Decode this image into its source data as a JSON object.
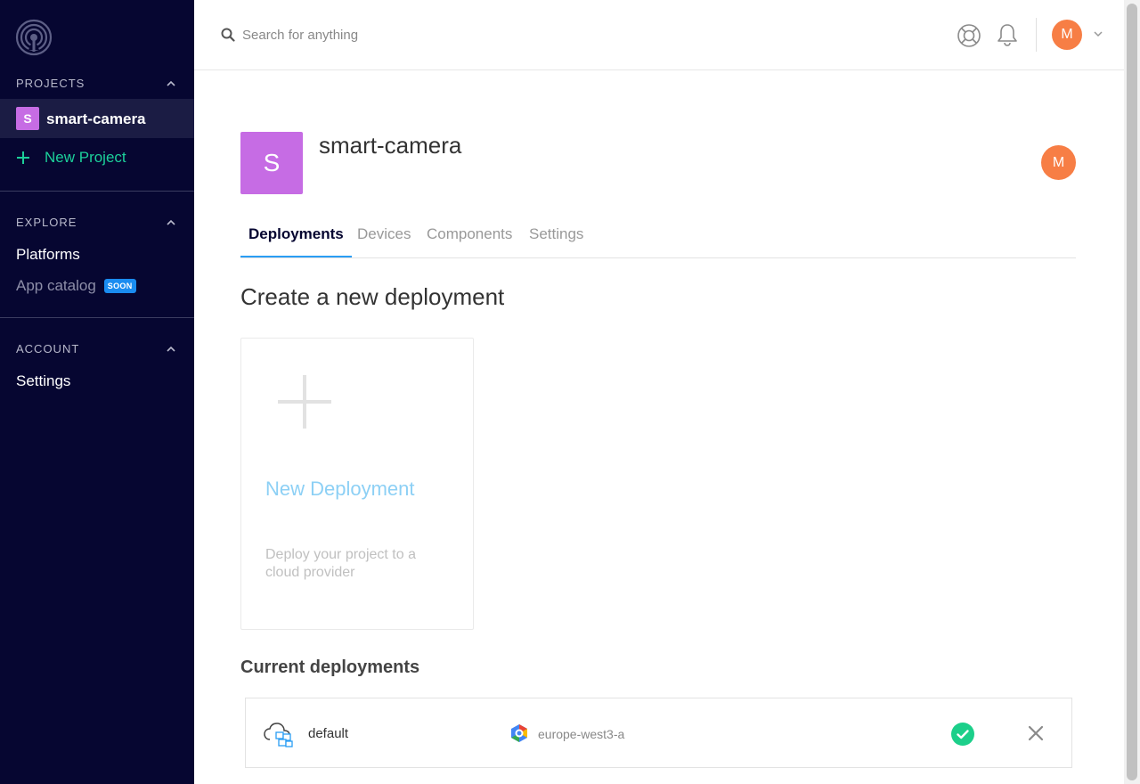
{
  "sidebar": {
    "sections": {
      "projects": "PROJECTS",
      "explore": "EXPLORE",
      "account": "ACCOUNT"
    },
    "project": {
      "badge": "S",
      "name": "smart-camera"
    },
    "new_project": "New Project",
    "explore_items": {
      "platforms": "Platforms",
      "app_catalog": "App catalog",
      "soon_badge": "SOON"
    },
    "account_items": {
      "settings": "Settings"
    }
  },
  "topbar": {
    "search_placeholder": "Search for anything",
    "avatar_initial": "M"
  },
  "project": {
    "badge": "S",
    "title": "smart-camera",
    "avatar_initial": "M"
  },
  "tabs": [
    "Deployments",
    "Devices",
    "Components",
    "Settings"
  ],
  "create": {
    "heading": "Create a new deployment",
    "card_title": "New Deployment",
    "card_description": "Deploy your project to a cloud provider"
  },
  "current": {
    "heading": "Current deployments",
    "rows": [
      {
        "name": "default",
        "region": "europe-west3-a",
        "status": "success"
      }
    ]
  },
  "colors": {
    "sidebar_bg": "#060631",
    "accent_green": "#1ccf9a",
    "project_purple": "#c66ce4",
    "avatar_orange": "#f77e45",
    "tab_underline": "#2a9df4",
    "soon_blue": "#1a8cf0"
  }
}
